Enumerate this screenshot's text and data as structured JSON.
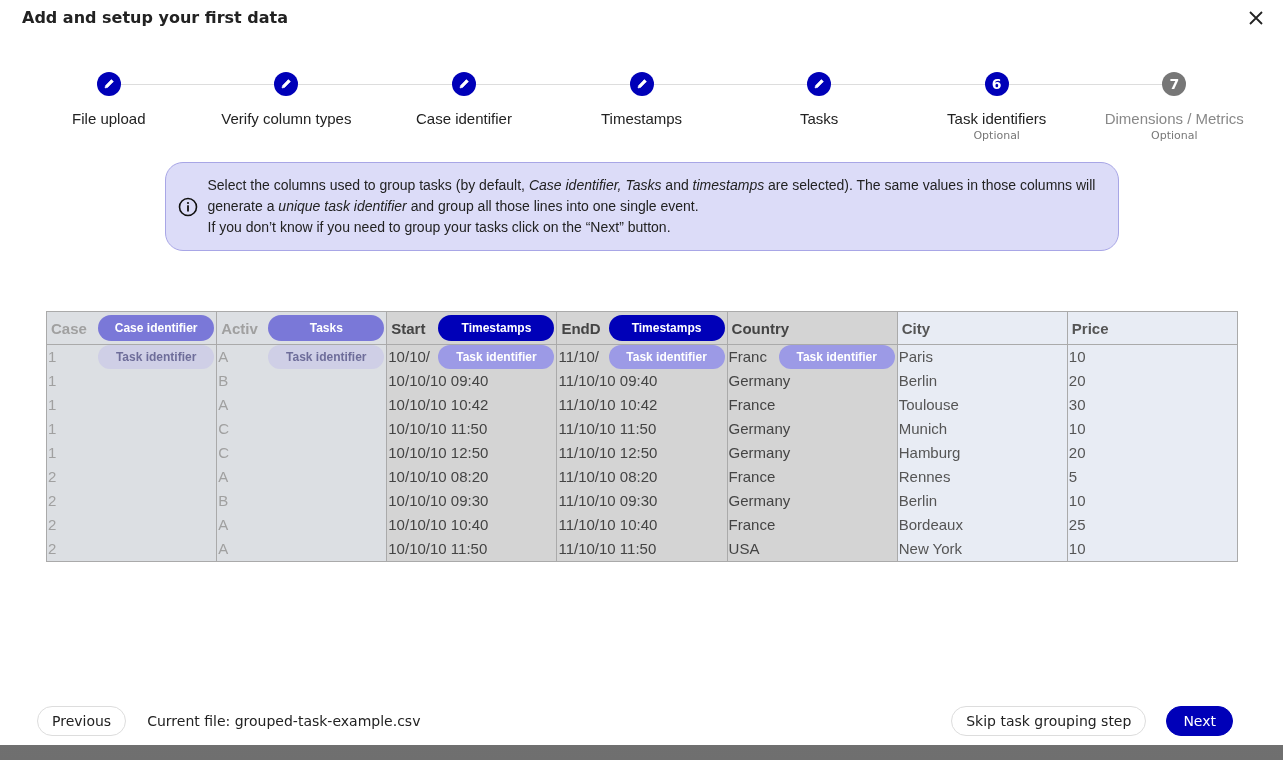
{
  "dialog": {
    "title": "Add and setup your first data"
  },
  "steps": [
    {
      "label": "File upload",
      "completed": true,
      "active": false
    },
    {
      "label": "Verify column types",
      "completed": true,
      "active": false
    },
    {
      "label": "Case identifier",
      "completed": true,
      "active": false
    },
    {
      "label": "Timestamps",
      "completed": true,
      "active": false
    },
    {
      "label": "Tasks",
      "completed": true,
      "active": false
    },
    {
      "label": "Task identifiers",
      "completed": false,
      "active": true,
      "number": "6",
      "note": "Optional"
    },
    {
      "label": "Dimensions / Metrics",
      "completed": false,
      "active": false,
      "number": "7",
      "note": "Optional"
    }
  ],
  "info": {
    "paragraphs": [
      "Select the columns used to group tasks (by default, *Case identifier, Tasks* and *timestamps* are selected). The same values in those columns will generate a *unique task identifier* and group all those lines into one single event.",
      "If you don’t know if you need to group your tasks click on the “Next” button."
    ]
  },
  "table": {
    "columns": [
      {
        "header": "Case",
        "kind": "locked",
        "header_tag": {
          "label": "Case identifier",
          "kind": "role"
        },
        "row_tag": {
          "label": "Task identifier",
          "selected": false
        }
      },
      {
        "header": "Activ",
        "kind": "locked",
        "header_tag": {
          "label": "Tasks",
          "kind": "role"
        },
        "row_tag": {
          "label": "Task identifier",
          "selected": false
        }
      },
      {
        "header": "Start",
        "kind": "selected",
        "header_tag": {
          "label": "Timestamps",
          "kind": "time"
        },
        "row_tag": {
          "label": "Task identifier",
          "selected": true
        }
      },
      {
        "header": "EndD",
        "kind": "selected",
        "header_tag": {
          "label": "Timestamps",
          "kind": "time"
        },
        "row_tag": {
          "label": "Task identifier",
          "selected": true
        }
      },
      {
        "header": "Country",
        "kind": "selected",
        "row_tag": {
          "label": "Task identifier",
          "selected": true
        }
      },
      {
        "header": "City",
        "kind": "available"
      },
      {
        "header": "Price",
        "kind": "available"
      }
    ],
    "rows": [
      [
        "1",
        "A",
        "10/10/",
        "11/10/",
        "Franc",
        "Paris",
        "10"
      ],
      [
        "1",
        "B",
        "10/10/10 09:40",
        "11/10/10 09:40",
        "Germany",
        "Berlin",
        "20"
      ],
      [
        "1",
        "A",
        "10/10/10 10:42",
        "11/10/10 10:42",
        "France",
        "Toulouse",
        "30"
      ],
      [
        "1",
        "C",
        "10/10/10 11:50",
        "11/10/10 11:50",
        "Germany",
        "Munich",
        "10"
      ],
      [
        "1",
        "C",
        "10/10/10 12:50",
        "11/10/10 12:50",
        "Germany",
        "Hamburg",
        "20"
      ],
      [
        "2",
        "A",
        "10/10/10 08:20",
        "11/10/10 08:20",
        "France",
        "Rennes",
        "5"
      ],
      [
        "2",
        "B",
        "10/10/10 09:30",
        "11/10/10 09:30",
        "Germany",
        "Berlin",
        "10"
      ],
      [
        "2",
        "A",
        "10/10/10 10:40",
        "11/10/10 10:40",
        "France",
        "Bordeaux",
        "25"
      ],
      [
        "2",
        "A",
        "10/10/10 11:50",
        "11/10/10 11:50",
        "USA",
        "New York",
        "10"
      ]
    ]
  },
  "footer": {
    "previous": "Previous",
    "current_file": "Current file: grouped-task-example.csv",
    "skip": "Skip task grouping step",
    "next": "Next"
  }
}
